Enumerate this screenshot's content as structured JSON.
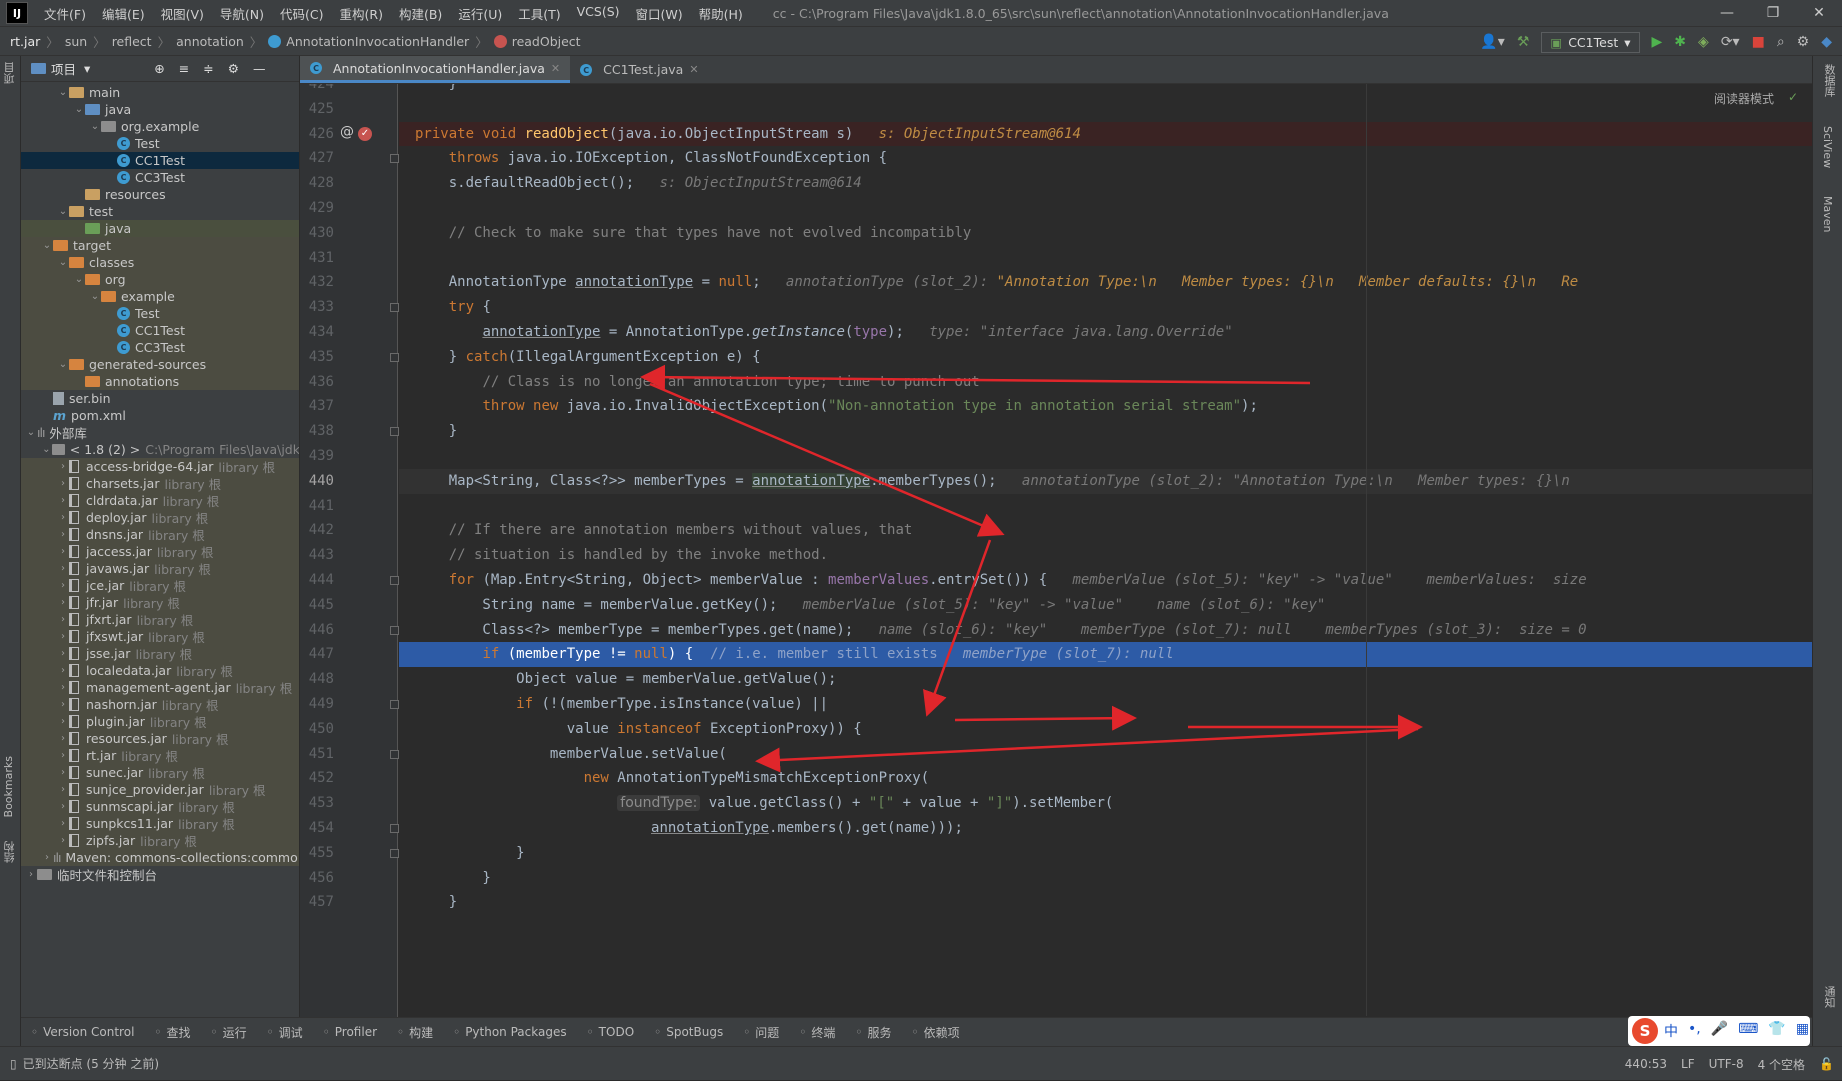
{
  "window": {
    "logo": "IJ",
    "menu": [
      "文件(F)",
      "编辑(E)",
      "视图(V)",
      "导航(N)",
      "代码(C)",
      "重构(R)",
      "构建(B)",
      "运行(U)",
      "工具(T)",
      "VCS(S)",
      "窗口(W)",
      "帮助(H)"
    ],
    "title": "cc - C:\\Program Files\\Java\\jdk1.8.0_65\\src\\sun\\reflect\\annotation\\AnnotationInvocationHandler.java",
    "controls": {
      "minimize": "—",
      "maximize": "❐",
      "close": "✕"
    }
  },
  "breadcrumb": [
    "rt.jar",
    "sun",
    "reflect",
    "annotation",
    "AnnotationInvocationHandler",
    "readObject"
  ],
  "toolbar": {
    "run_config": "CC1Test",
    "icons": [
      "user-icon",
      "hammer-icon",
      "run-icon",
      "debug-icon",
      "coverage-icon",
      "profile-icon",
      "stop-icon",
      "search-icon",
      "gear-icon",
      "jetbrains-icon"
    ]
  },
  "left_strip": {
    "project": "项目",
    "bookmarks": "Bookmarks",
    "structure": "结构"
  },
  "project_panel": {
    "title": "项目",
    "tree": [
      {
        "indent": 2,
        "arrow": "v",
        "icon": "folder",
        "label": "main"
      },
      {
        "indent": 3,
        "arrow": "v",
        "icon": "folder-blue",
        "label": "java"
      },
      {
        "indent": 4,
        "arrow": "v",
        "icon": "package",
        "label": "org.example"
      },
      {
        "indent": 5,
        "arrow": "",
        "icon": "class",
        "label": "Test"
      },
      {
        "indent": 5,
        "arrow": "",
        "icon": "class",
        "label": "CC1Test",
        "selected": true
      },
      {
        "indent": 5,
        "arrow": "",
        "icon": "class",
        "label": "CC3Test"
      },
      {
        "indent": 3,
        "arrow": "",
        "icon": "folder",
        "label": "resources"
      },
      {
        "indent": 2,
        "arrow": "v",
        "icon": "folder",
        "label": "test"
      },
      {
        "indent": 3,
        "arrow": "",
        "icon": "folder-green",
        "label": "java",
        "selected_light": true
      },
      {
        "indent": 1,
        "arrow": "v",
        "icon": "folder-orange",
        "label": "target"
      },
      {
        "indent": 2,
        "arrow": "v",
        "icon": "folder-orange",
        "label": "classes"
      },
      {
        "indent": 3,
        "arrow": "v",
        "icon": "folder-orange",
        "label": "org"
      },
      {
        "indent": 4,
        "arrow": "v",
        "icon": "folder-orange",
        "label": "example"
      },
      {
        "indent": 5,
        "arrow": "",
        "icon": "class",
        "label": "Test"
      },
      {
        "indent": 5,
        "arrow": "",
        "icon": "class",
        "label": "CC1Test"
      },
      {
        "indent": 5,
        "arrow": "",
        "icon": "class",
        "label": "CC3Test"
      },
      {
        "indent": 2,
        "arrow": "v",
        "icon": "folder-orange",
        "label": "generated-sources"
      },
      {
        "indent": 3,
        "arrow": "",
        "icon": "folder-orange",
        "label": "annotations"
      },
      {
        "indent": 1,
        "arrow": "",
        "icon": "file",
        "label": "ser.bin"
      },
      {
        "indent": 1,
        "arrow": "",
        "icon": "maven",
        "label": "pom.xml"
      },
      {
        "indent": 0,
        "arrow": "v",
        "icon": "libraries",
        "label": "外部库"
      },
      {
        "indent": 1,
        "arrow": "v",
        "icon": "folder-gray",
        "label": "< 1.8 (2) >",
        "suffix": "C:\\Program Files\\Java\\jdk"
      },
      {
        "indent": 2,
        "arrow": ">",
        "icon": "jar",
        "label": "access-bridge-64.jar",
        "suffix": "library 根"
      },
      {
        "indent": 2,
        "arrow": ">",
        "icon": "jar",
        "label": "charsets.jar",
        "suffix": "library 根"
      },
      {
        "indent": 2,
        "arrow": ">",
        "icon": "jar",
        "label": "cldrdata.jar",
        "suffix": "library 根"
      },
      {
        "indent": 2,
        "arrow": ">",
        "icon": "jar",
        "label": "deploy.jar",
        "suffix": "library 根"
      },
      {
        "indent": 2,
        "arrow": ">",
        "icon": "jar",
        "label": "dnsns.jar",
        "suffix": "library 根"
      },
      {
        "indent": 2,
        "arrow": ">",
        "icon": "jar",
        "label": "jaccess.jar",
        "suffix": "library 根"
      },
      {
        "indent": 2,
        "arrow": ">",
        "icon": "jar",
        "label": "javaws.jar",
        "suffix": "library 根"
      },
      {
        "indent": 2,
        "arrow": ">",
        "icon": "jar",
        "label": "jce.jar",
        "suffix": "library 根"
      },
      {
        "indent": 2,
        "arrow": ">",
        "icon": "jar",
        "label": "jfr.jar",
        "suffix": "library 根"
      },
      {
        "indent": 2,
        "arrow": ">",
        "icon": "jar",
        "label": "jfxrt.jar",
        "suffix": "library 根"
      },
      {
        "indent": 2,
        "arrow": ">",
        "icon": "jar",
        "label": "jfxswt.jar",
        "suffix": "library 根"
      },
      {
        "indent": 2,
        "arrow": ">",
        "icon": "jar",
        "label": "jsse.jar",
        "suffix": "library 根"
      },
      {
        "indent": 2,
        "arrow": ">",
        "icon": "jar",
        "label": "localedata.jar",
        "suffix": "library 根"
      },
      {
        "indent": 2,
        "arrow": ">",
        "icon": "jar",
        "label": "management-agent.jar",
        "suffix": "library 根"
      },
      {
        "indent": 2,
        "arrow": ">",
        "icon": "jar",
        "label": "nashorn.jar",
        "suffix": "library 根"
      },
      {
        "indent": 2,
        "arrow": ">",
        "icon": "jar",
        "label": "plugin.jar",
        "suffix": "library 根"
      },
      {
        "indent": 2,
        "arrow": ">",
        "icon": "jar",
        "label": "resources.jar",
        "suffix": "library 根"
      },
      {
        "indent": 2,
        "arrow": ">",
        "icon": "jar",
        "label": "rt.jar",
        "suffix": "library 根"
      },
      {
        "indent": 2,
        "arrow": ">",
        "icon": "jar",
        "label": "sunec.jar",
        "suffix": "library 根"
      },
      {
        "indent": 2,
        "arrow": ">",
        "icon": "jar",
        "label": "sunjce_provider.jar",
        "suffix": "library 根"
      },
      {
        "indent": 2,
        "arrow": ">",
        "icon": "jar",
        "label": "sunmscapi.jar",
        "suffix": "library 根"
      },
      {
        "indent": 2,
        "arrow": ">",
        "icon": "jar",
        "label": "sunpkcs11.jar",
        "suffix": "library 根"
      },
      {
        "indent": 2,
        "arrow": ">",
        "icon": "jar",
        "label": "zipfs.jar",
        "suffix": "library 根"
      },
      {
        "indent": 1,
        "arrow": ">",
        "icon": "libraries",
        "label": "Maven: commons-collections:commo"
      },
      {
        "indent": 0,
        "arrow": ">",
        "icon": "scratch",
        "label": "临时文件和控制台"
      }
    ]
  },
  "editor_tabs": [
    {
      "label": "AnnotationInvocationHandler.java",
      "active": true
    },
    {
      "label": "CC1Test.java",
      "active": false
    }
  ],
  "editor": {
    "reader_mode": "阅读器模式",
    "lines": [
      {
        "n": "424",
        "html": "    }"
      },
      {
        "n": "425",
        "html": ""
      },
      {
        "n": "426",
        "bp": true,
        "html": "<span class='kw'>private void </span><span class='fn'>readObject</span>(java.io.ObjectInputStream s)   <span class='hintv'>s: ObjectInputStream@614</span>"
      },
      {
        "n": "427",
        "html": "    <span class='kw'>throws </span>java.io.IOException, ClassNotFoundException {"
      },
      {
        "n": "428",
        "html": "    s.defaultReadObject();   <span class='hint'>s: ObjectInputStream@614</span>"
      },
      {
        "n": "429",
        "html": ""
      },
      {
        "n": "430",
        "html": "    <span class='cmt'>// Check to make sure that types have not evolved incompatibly</span>"
      },
      {
        "n": "431",
        "html": ""
      },
      {
        "n": "432",
        "html": "    AnnotationType <span class='ul'>annotationType</span> = <span class='kw'>null</span>;   <span class='hint'>annotationType (slot_2): </span><span class='hintv'>\"Annotation Type:\\n   Member types: {}\\n   Member defaults: {}\\n   Re</span>"
      },
      {
        "n": "433",
        "html": "    <span class='kw'>try </span>{"
      },
      {
        "n": "434",
        "html": "        <span class='ul'>annotationType</span> = AnnotationType.<span class='it'>getInstance</span>(<span class='fld'>type</span>);   <span class='hint'>type: \"interface java.lang.Override\"</span>"
      },
      {
        "n": "435",
        "html": "    } <span class='kw'>catch</span>(IllegalArgumentException e) {"
      },
      {
        "n": "436",
        "html": "        <span class='cmt'>// Class is no longer an annotation type; time to punch out</span>"
      },
      {
        "n": "437",
        "html": "        <span class='kw'>throw new </span>java.io.InvalidObjectException(<span class='str'>\"Non-annotation type in annotation serial stream\"</span>);"
      },
      {
        "n": "438",
        "html": "    }"
      },
      {
        "n": "439",
        "html": ""
      },
      {
        "n": "440",
        "cur": true,
        "html": "    Map&lt;String, Class&lt;?&gt;&gt; memberTypes = <span class='hl-var ul'>annotationType</span>.memberTypes();   <span class='hint'>annotationType (slot_2): \"Annotation Type:\\n   Member types: {}\\n</span>"
      },
      {
        "n": "441",
        "html": ""
      },
      {
        "n": "442",
        "html": "    <span class='cmt'>// If there are annotation members without values, that</span>"
      },
      {
        "n": "443",
        "html": "    <span class='cmt'>// situation is handled by the invoke method.</span>"
      },
      {
        "n": "444",
        "html": "    <span class='kw'>for </span>(Map.Entry&lt;String, Object&gt; memberValue : <span class='fld'>memberValues</span>.entrySet()) {   <span class='hint'>memberValue (slot_5): \"key\" -&gt; \"value\"    memberValues:  size</span>"
      },
      {
        "n": "445",
        "html": "        String name = memberValue.getKey();   <span class='hint'>memberValue (slot_5): \"key\" -&gt; \"value\"    name (slot_6): \"key\"</span>"
      },
      {
        "n": "446",
        "html": "        Class&lt;?&gt; memberType = memberTypes.get(name);   <span class='hint'>name (slot_6): \"key\"    memberType (slot_7): null    memberTypes (slot_3):  size = 0</span>"
      },
      {
        "n": "447",
        "exec": true,
        "html": "        <span class='kw'>if </span>(memberType != <span class='kw'>null</span>) {  <span class='cmt'>// i.e. member still exists</span>   <span class='hint'>memberType (slot_7): null</span>"
      },
      {
        "n": "448",
        "html": "            Object value = memberValue.getValue();"
      },
      {
        "n": "449",
        "html": "            <span class='kw'>if </span>(!(memberType.isInstance(value) ||"
      },
      {
        "n": "450",
        "html": "                  value <span class='kw'>instanceof </span>ExceptionProxy)) {"
      },
      {
        "n": "451",
        "html": "                memberValue.setValue("
      },
      {
        "n": "452",
        "html": "                    <span class='kw'>new </span>AnnotationTypeMismatchExceptionProxy("
      },
      {
        "n": "453",
        "html": "                        <span class='inline-hint'>foundType:</span> value.getClass() + <span class='str'>\"[\"</span> + value + <span class='str'>\"]\"</span>).setMember("
      },
      {
        "n": "454",
        "html": "                            <span class='ul'>annotationType</span>.members().get(name)));"
      },
      {
        "n": "455",
        "html": "            }"
      },
      {
        "n": "456",
        "html": "        }"
      },
      {
        "n": "457",
        "html": "    }"
      }
    ]
  },
  "right_strip": {
    "database": "数据库",
    "sciview": "SciView",
    "maven": "Maven",
    "notifications": "通知"
  },
  "bottom_tools": [
    {
      "icon": "vcs-icon",
      "label": "Version Control"
    },
    {
      "icon": "search-icon",
      "label": "查找"
    },
    {
      "icon": "run-icon",
      "label": "运行"
    },
    {
      "icon": "debug-icon",
      "label": "调试"
    },
    {
      "icon": "profiler-icon",
      "label": "Profiler"
    },
    {
      "icon": "build-icon",
      "label": "构建"
    },
    {
      "icon": "python-packages-icon",
      "label": "Python Packages"
    },
    {
      "icon": "todo-icon",
      "label": "TODO"
    },
    {
      "icon": "spotbugs-icon",
      "label": "SpotBugs"
    },
    {
      "icon": "problems-icon",
      "label": "问题"
    },
    {
      "icon": "terminal-icon",
      "label": "终端"
    },
    {
      "icon": "services-icon",
      "label": "服务"
    },
    {
      "icon": "dependencies-icon",
      "label": "依赖项"
    }
  ],
  "status": {
    "message": "已到达断点 (5 分钟 之前)",
    "position": "440:53",
    "line_sep": "LF",
    "encoding": "UTF-8",
    "indent": "4 个空格"
  },
  "ime": {
    "logo": "S",
    "items": [
      "中",
      "•,",
      "🎤",
      "⌨",
      "👕",
      "▦"
    ]
  },
  "colors": {
    "exec_line": "#2d5ba6",
    "breakpoint_line": "#3a2323",
    "arrow": "#e0262b"
  }
}
